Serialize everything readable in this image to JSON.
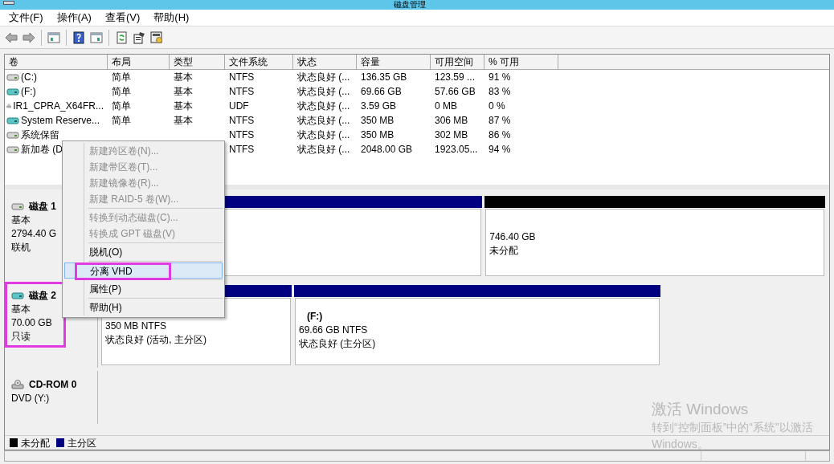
{
  "window": {
    "title": "磁盘管理"
  },
  "menu": [
    "文件(F)",
    "操作(A)",
    "查看(V)",
    "帮助(H)"
  ],
  "toolbar": [
    {
      "kind": "back"
    },
    {
      "kind": "forward"
    },
    {
      "kind": "sep"
    },
    {
      "kind": "panel"
    },
    {
      "kind": "sep"
    },
    {
      "kind": "help"
    },
    {
      "kind": "panel2"
    },
    {
      "kind": "sep"
    },
    {
      "kind": "refresh"
    },
    {
      "kind": "props"
    },
    {
      "kind": "settings"
    }
  ],
  "table": {
    "columns": [
      "卷",
      "布局",
      "类型",
      "文件系统",
      "状态",
      "容量",
      "可用空间",
      "% 可用"
    ],
    "rows": [
      {
        "kind": "disk",
        "cells": [
          "(C:)",
          "简单",
          "基本",
          "NTFS",
          "状态良好 (...",
          "136.35 GB",
          "123.59 ...",
          "91 %"
        ]
      },
      {
        "kind": "vhd",
        "cells": [
          "(F:)",
          "简单",
          "基本",
          "NTFS",
          "状态良好 (...",
          "69.66 GB",
          "57.66 GB",
          "83 %"
        ]
      },
      {
        "kind": "cd",
        "cells": [
          "IR1_CPRA_X64FR...",
          "简单",
          "基本",
          "UDF",
          "状态良好 (...",
          "3.59 GB",
          "0 MB",
          "0 %"
        ]
      },
      {
        "kind": "vhd",
        "cells": [
          "System Reserve...",
          "简单",
          "基本",
          "NTFS",
          "状态良好 (...",
          "350 MB",
          "306 MB",
          "87 %"
        ]
      },
      {
        "kind": "disk",
        "cells": [
          "系统保留",
          "",
          "",
          "NTFS",
          "状态良好 (...",
          "350 MB",
          "302 MB",
          "86 %"
        ]
      },
      {
        "kind": "disk",
        "cells": [
          "新加卷 (D",
          "",
          "",
          "NTFS",
          "状态良好 (...",
          "2048.00 GB",
          "1923.05...",
          "94 %"
        ]
      }
    ]
  },
  "disks": [
    {
      "kind": "disk",
      "name": "磁盘 1",
      "lines": [
        "基本",
        "2794.40 G",
        "联机"
      ],
      "highlighted": false,
      "partitions": [
        {
          "color": "#000080"
        },
        {
          "color": "#000000",
          "lines": [
            "746.40 GB",
            "未分配"
          ]
        }
      ]
    },
    {
      "kind": "vhd",
      "name": "磁盘 2",
      "lines": [
        "基本",
        "70.00 GB",
        "只读"
      ],
      "highlighted": true,
      "partitions": [
        {
          "color": "#000080",
          "lines": [
            "350 MB NTFS",
            "状态良好 (活动, 主分区)"
          ]
        },
        {
          "color": "#000080",
          "label": "(F:)",
          "lines": [
            "69.66 GB NTFS",
            "状态良好 (主分区)"
          ]
        }
      ]
    },
    {
      "kind": "cd",
      "name": "CD-ROM 0",
      "lines": [
        "DVD (Y:)"
      ],
      "highlighted": false
    }
  ],
  "context_menu": [
    {
      "label": "新建跨区卷(N)...",
      "disabled": true,
      "selected": false,
      "highlighted": false,
      "sep_after": false
    },
    {
      "label": "新建带区卷(T)...",
      "disabled": true,
      "selected": false,
      "highlighted": false,
      "sep_after": false
    },
    {
      "label": "新建镜像卷(R)...",
      "disabled": true,
      "selected": false,
      "highlighted": false,
      "sep_after": false
    },
    {
      "label": "新建 RAID-5 卷(W)...",
      "disabled": true,
      "selected": false,
      "highlighted": false,
      "sep_after": true
    },
    {
      "label": "转换到动态磁盘(C)...",
      "disabled": true,
      "selected": false,
      "highlighted": false,
      "sep_after": false
    },
    {
      "label": "转换成 GPT 磁盘(V)",
      "disabled": true,
      "selected": false,
      "highlighted": false,
      "sep_after": true
    },
    {
      "label": "脱机(O)",
      "disabled": false,
      "selected": false,
      "highlighted": false,
      "sep_after": true
    },
    {
      "label": "分离 VHD",
      "disabled": false,
      "selected": true,
      "highlighted": true,
      "sep_after": true
    },
    {
      "label": "属性(P)",
      "disabled": false,
      "selected": false,
      "highlighted": false,
      "sep_after": true
    },
    {
      "label": "帮助(H)",
      "disabled": false,
      "selected": false,
      "highlighted": false,
      "sep_after": false
    }
  ],
  "legend": [
    {
      "label": "未分配",
      "color": "#000000"
    },
    {
      "label": "主分区",
      "color": "#000080"
    }
  ],
  "activation": [
    "激活 Windows",
    "转到“控制面板”中的“系统”以激活",
    "Windows。"
  ]
}
